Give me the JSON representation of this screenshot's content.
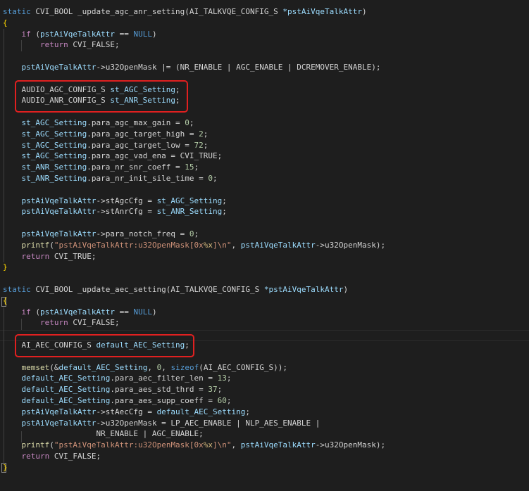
{
  "colors": {
    "background": "#1e1e1e",
    "text": "#d4d4d4",
    "keyword": "#569cd6",
    "control": "#c586c0",
    "function": "#dcdcaa",
    "string": "#ce9178",
    "number": "#b5cea8",
    "variable": "#9cdcfe",
    "brace": "#ffd700",
    "highlight_box": "#e02020"
  },
  "lines": [
    [
      [
        "static ",
        "k"
      ],
      [
        "CVI_BOOL _update_agc_anr_setting(AI_TALKVQE_CONFIG_S ",
        ""
      ],
      [
        "*pstAiVqeTalkAttr",
        "v"
      ],
      [
        ")",
        ""
      ]
    ],
    [
      [
        "{",
        "y"
      ]
    ],
    [
      [
        "    ",
        ""
      ],
      [
        "if",
        "c"
      ],
      [
        " (",
        ""
      ],
      [
        "pstAiVqeTalkAttr",
        "v"
      ],
      [
        " == ",
        ""
      ],
      [
        "NULL",
        "k"
      ],
      [
        ")",
        ""
      ]
    ],
    [
      [
        "        ",
        ""
      ],
      [
        "return",
        "c"
      ],
      [
        " CVI_FALSE;",
        ""
      ]
    ],
    [],
    [
      [
        "    ",
        ""
      ],
      [
        "pstAiVqeTalkAttr",
        "v"
      ],
      [
        "->u32OpenMask |= (NR_ENABLE | AGC_ENABLE | DCREMOVER_ENABLE);",
        ""
      ]
    ],
    [],
    [
      [
        "    AUDIO_AGC_CONFIG_S ",
        ""
      ],
      [
        "st_AGC_Setting",
        "v"
      ],
      [
        ";",
        ""
      ]
    ],
    [
      [
        "    AUDIO_ANR_CONFIG_S ",
        ""
      ],
      [
        "st_ANR_Setting",
        "v"
      ],
      [
        ";",
        ""
      ]
    ],
    [],
    [
      [
        "    ",
        ""
      ],
      [
        "st_AGC_Setting",
        "v"
      ],
      [
        ".para_agc_max_gain = ",
        ""
      ],
      [
        "0",
        "n"
      ],
      [
        ";",
        ""
      ]
    ],
    [
      [
        "    ",
        ""
      ],
      [
        "st_AGC_Setting",
        "v"
      ],
      [
        ".para_agc_target_high = ",
        ""
      ],
      [
        "2",
        "n"
      ],
      [
        ";",
        ""
      ]
    ],
    [
      [
        "    ",
        ""
      ],
      [
        "st_AGC_Setting",
        "v"
      ],
      [
        ".para_agc_target_low = ",
        ""
      ],
      [
        "72",
        "n"
      ],
      [
        ";",
        ""
      ]
    ],
    [
      [
        "    ",
        ""
      ],
      [
        "st_AGC_Setting",
        "v"
      ],
      [
        ".para_agc_vad_ena = CVI_TRUE;",
        ""
      ]
    ],
    [
      [
        "    ",
        ""
      ],
      [
        "st_ANR_Setting",
        "v"
      ],
      [
        ".para_nr_snr_coeff = ",
        ""
      ],
      [
        "15",
        "n"
      ],
      [
        ";",
        ""
      ]
    ],
    [
      [
        "    ",
        ""
      ],
      [
        "st_ANR_Setting",
        "v"
      ],
      [
        ".para_nr_init_sile_time = ",
        ""
      ],
      [
        "0",
        "n"
      ],
      [
        ";",
        ""
      ]
    ],
    [],
    [
      [
        "    ",
        ""
      ],
      [
        "pstAiVqeTalkAttr",
        "v"
      ],
      [
        "->stAgcCfg = ",
        ""
      ],
      [
        "st_AGC_Setting",
        "v"
      ],
      [
        ";",
        ""
      ]
    ],
    [
      [
        "    ",
        ""
      ],
      [
        "pstAiVqeTalkAttr",
        "v"
      ],
      [
        "->stAnrCfg = ",
        ""
      ],
      [
        "st_ANR_Setting",
        "v"
      ],
      [
        ";",
        ""
      ]
    ],
    [],
    [
      [
        "    ",
        ""
      ],
      [
        "pstAiVqeTalkAttr",
        "v"
      ],
      [
        "->para_notch_freq = ",
        ""
      ],
      [
        "0",
        "n"
      ],
      [
        ";",
        ""
      ]
    ],
    [
      [
        "    ",
        ""
      ],
      [
        "printf",
        "t"
      ],
      [
        "(",
        ""
      ],
      [
        "\"pstAiVqeTalkAttr:u32OpenMask[0x",
        "s"
      ],
      [
        "%x",
        "e"
      ],
      [
        "]\\n\"",
        "s"
      ],
      [
        ", ",
        ""
      ],
      [
        "pstAiVqeTalkAttr",
        "v"
      ],
      [
        "->u32OpenMask);",
        ""
      ]
    ],
    [
      [
        "    ",
        ""
      ],
      [
        "return",
        "c"
      ],
      [
        " CVI_TRUE;",
        ""
      ]
    ],
    [
      [
        "}",
        "y"
      ]
    ],
    [],
    [
      [
        "static ",
        "k"
      ],
      [
        "CVI_BOOL _update_aec_setting(AI_TALKVQE_CONFIG_S ",
        ""
      ],
      [
        "*pstAiVqeTalkAttr",
        "v"
      ],
      [
        ")",
        ""
      ]
    ],
    [
      [
        "{",
        "y"
      ]
    ],
    [
      [
        "    ",
        ""
      ],
      [
        "if",
        "c"
      ],
      [
        " (",
        ""
      ],
      [
        "pstAiVqeTalkAttr",
        "v"
      ],
      [
        " == ",
        ""
      ],
      [
        "NULL",
        "k"
      ],
      [
        ")",
        ""
      ]
    ],
    [
      [
        "        ",
        ""
      ],
      [
        "return",
        "c"
      ],
      [
        " CVI_FALSE;",
        ""
      ]
    ],
    [],
    [
      [
        "    AI_AEC_CONFIG_S ",
        ""
      ],
      [
        "default_AEC_Setting",
        "v"
      ],
      [
        ";",
        ""
      ]
    ],
    [],
    [
      [
        "    ",
        ""
      ],
      [
        "memset",
        "t"
      ],
      [
        "(&",
        ""
      ],
      [
        "default_AEC_Setting",
        "v"
      ],
      [
        ", ",
        ""
      ],
      [
        "0",
        "n"
      ],
      [
        ", ",
        ""
      ],
      [
        "sizeof",
        "k"
      ],
      [
        "(AI_AEC_CONFIG_S));",
        ""
      ]
    ],
    [
      [
        "    ",
        ""
      ],
      [
        "default_AEC_Setting",
        "v"
      ],
      [
        ".para_aec_filter_len = ",
        ""
      ],
      [
        "13",
        "n"
      ],
      [
        ";",
        ""
      ]
    ],
    [
      [
        "    ",
        ""
      ],
      [
        "default_AEC_Setting",
        "v"
      ],
      [
        ".para_aes_std_thrd = ",
        ""
      ],
      [
        "37",
        "n"
      ],
      [
        ";",
        ""
      ]
    ],
    [
      [
        "    ",
        ""
      ],
      [
        "default_AEC_Setting",
        "v"
      ],
      [
        ".para_aes_supp_coeff = ",
        ""
      ],
      [
        "60",
        "n"
      ],
      [
        ";",
        ""
      ]
    ],
    [
      [
        "    ",
        ""
      ],
      [
        "pstAiVqeTalkAttr",
        "v"
      ],
      [
        "->stAecCfg = ",
        ""
      ],
      [
        "default_AEC_Setting",
        "v"
      ],
      [
        ";",
        ""
      ]
    ],
    [
      [
        "    ",
        ""
      ],
      [
        "pstAiVqeTalkAttr",
        "v"
      ],
      [
        "->u32OpenMask = LP_AEC_ENABLE | NLP_AES_ENABLE |",
        ""
      ]
    ],
    [
      [
        "                    NR_ENABLE | AGC_ENABLE;",
        ""
      ]
    ],
    [
      [
        "    ",
        ""
      ],
      [
        "printf",
        "t"
      ],
      [
        "(",
        ""
      ],
      [
        "\"pstAiVqeTalkAttr:u32OpenMask[0x",
        "s"
      ],
      [
        "%x",
        "e"
      ],
      [
        "]\\n\"",
        "s"
      ],
      [
        ", ",
        ""
      ],
      [
        "pstAiVqeTalkAttr",
        "v"
      ],
      [
        "->u32OpenMask);",
        ""
      ]
    ],
    [
      [
        "    ",
        ""
      ],
      [
        "return",
        "c"
      ],
      [
        " CVI_FALSE;",
        ""
      ]
    ],
    [
      [
        "}",
        "y"
      ]
    ]
  ]
}
